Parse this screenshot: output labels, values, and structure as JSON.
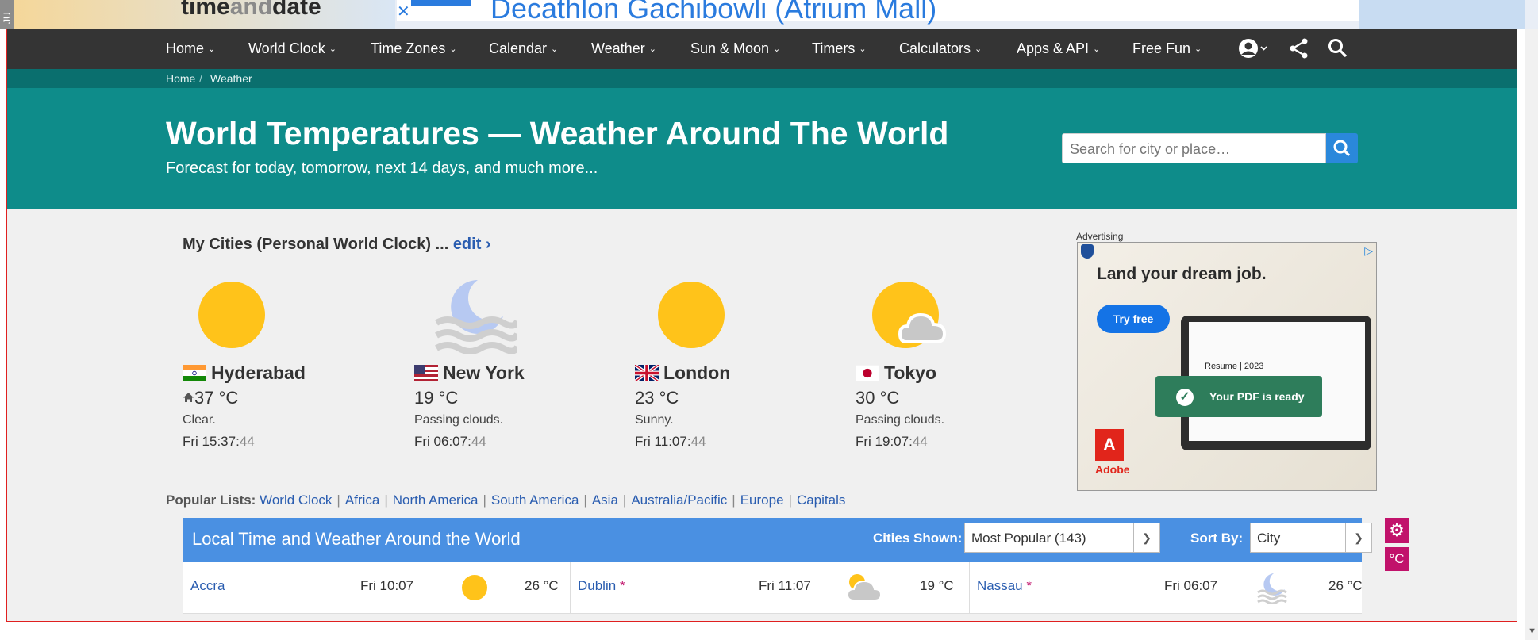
{
  "browser": {
    "side_tab_label": "JU",
    "logo_prefix": "time",
    "logo_mid": "and",
    "logo_suffix": "date",
    "ad_close": "✕",
    "ad_banner_text": "Decathlon Gachibowli (Atrium Mall)"
  },
  "nav": {
    "items": [
      {
        "label": "Home"
      },
      {
        "label": "World Clock"
      },
      {
        "label": "Time Zones"
      },
      {
        "label": "Calendar"
      },
      {
        "label": "Weather"
      },
      {
        "label": "Sun & Moon"
      },
      {
        "label": "Timers"
      },
      {
        "label": "Calculators"
      },
      {
        "label": "Apps & API"
      },
      {
        "label": "Free Fun"
      }
    ],
    "chevron": "⌄",
    "icons": [
      "account-icon",
      "share-icon",
      "search-icon"
    ]
  },
  "breadcrumb": [
    "Home",
    "Weather"
  ],
  "breadcrumb_sep": "/",
  "hero": {
    "title": "World Temperatures — Weather Around The World",
    "subtitle": "Forecast for today, tomorrow, next 14 days, and much more...",
    "search_placeholder": "Search for city or place…"
  },
  "my_cities": {
    "heading": "My Cities (Personal World Clock) ... ",
    "edit_label": "edit ›",
    "cities": [
      {
        "name": "Hyderabad",
        "flag": "india",
        "temp": "37 °C",
        "home": true,
        "desc": "Clear.",
        "time": "Fri 15:37:",
        "sec": "44",
        "icon": "sun"
      },
      {
        "name": "New York",
        "flag": "usa",
        "temp": "19 °C",
        "home": false,
        "desc": "Passing clouds.",
        "time": "Fri 06:07:",
        "sec": "44",
        "icon": "moon-fog"
      },
      {
        "name": "London",
        "flag": "uk",
        "temp": "23 °C",
        "home": false,
        "desc": "Sunny.",
        "time": "Fri 11:07:",
        "sec": "44",
        "icon": "sun"
      },
      {
        "name": "Tokyo",
        "flag": "japan",
        "temp": "30 °C",
        "home": false,
        "desc": "Passing clouds.",
        "time": "Fri 19:07:",
        "sec": "44",
        "icon": "sun-cloud"
      }
    ]
  },
  "ad": {
    "label": "Advertising",
    "headline": "Land your dream job.",
    "button": "Try free",
    "toast": "Your PDF is ready",
    "resume": "Resume | 2023",
    "brand": "Adobe"
  },
  "popular": {
    "label": "Popular Lists:",
    "links": [
      "World Clock",
      "Africa",
      "North America",
      "South America",
      "Asia",
      "Australia/Pacific",
      "Europe",
      "Capitals"
    ]
  },
  "table": {
    "title": "Local Time and Weather Around the World",
    "cities_shown_label": "Cities Shown:",
    "cities_shown_value": "Most Popular (143)",
    "sort_by_label": "Sort By:",
    "sort_by_value": "City",
    "celsius_label": "°C",
    "rows": [
      {
        "city": "Accra",
        "dst": false,
        "time": "Fri 10:07",
        "temp": "26 °C",
        "icon": "sun"
      },
      {
        "city": "Dublin",
        "dst": true,
        "time": "Fri 11:07",
        "temp": "19 °C",
        "icon": "sun-cloud"
      },
      {
        "city": "Nassau",
        "dst": true,
        "time": "Fri 06:07",
        "temp": "26 °C",
        "icon": "moon-fog"
      }
    ]
  },
  "colors": {
    "nav_bg": "#343434",
    "hero_bg": "#0e8c8a",
    "accent": "#4a90e2",
    "link": "#2a5db0",
    "magenta": "#c1126b",
    "sun": "#ffc31a"
  }
}
